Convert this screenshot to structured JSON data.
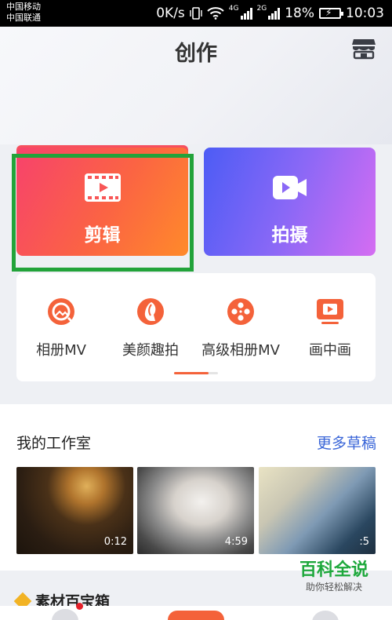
{
  "status_bar": {
    "carrier1": "中国移动",
    "carrier2": "中国联通",
    "speed": "0K/s",
    "net1": "4G",
    "net2": "2G",
    "battery": "18%",
    "time": "10:03"
  },
  "header": {
    "title": "创作",
    "store_icon": "store-icon"
  },
  "cards": [
    {
      "label": "剪辑",
      "icon": "film-icon"
    },
    {
      "label": "拍摄",
      "icon": "video-camera-icon"
    }
  ],
  "tools": [
    {
      "label": "相册MV",
      "icon": "album-icon"
    },
    {
      "label": "美颜趣拍",
      "icon": "beauty-icon"
    },
    {
      "label": "高级相册MV",
      "icon": "film-reel-icon"
    },
    {
      "label": "画中画",
      "icon": "pip-icon"
    }
  ],
  "tools_pager": {
    "page": 1,
    "pages": 2
  },
  "studio": {
    "title": "我的工作室",
    "more": "更多草稿",
    "drafts": [
      {
        "duration": "0:12"
      },
      {
        "duration": "4:59"
      },
      {
        "duration": ":5"
      }
    ]
  },
  "treasure": {
    "title": "素材百宝箱"
  },
  "watermark": {
    "main": "百科全说",
    "sub": "助你轻松解决"
  },
  "colors": {
    "accent": "#f4623a",
    "link": "#3a66d8",
    "highlight_box": "#22a33a"
  }
}
